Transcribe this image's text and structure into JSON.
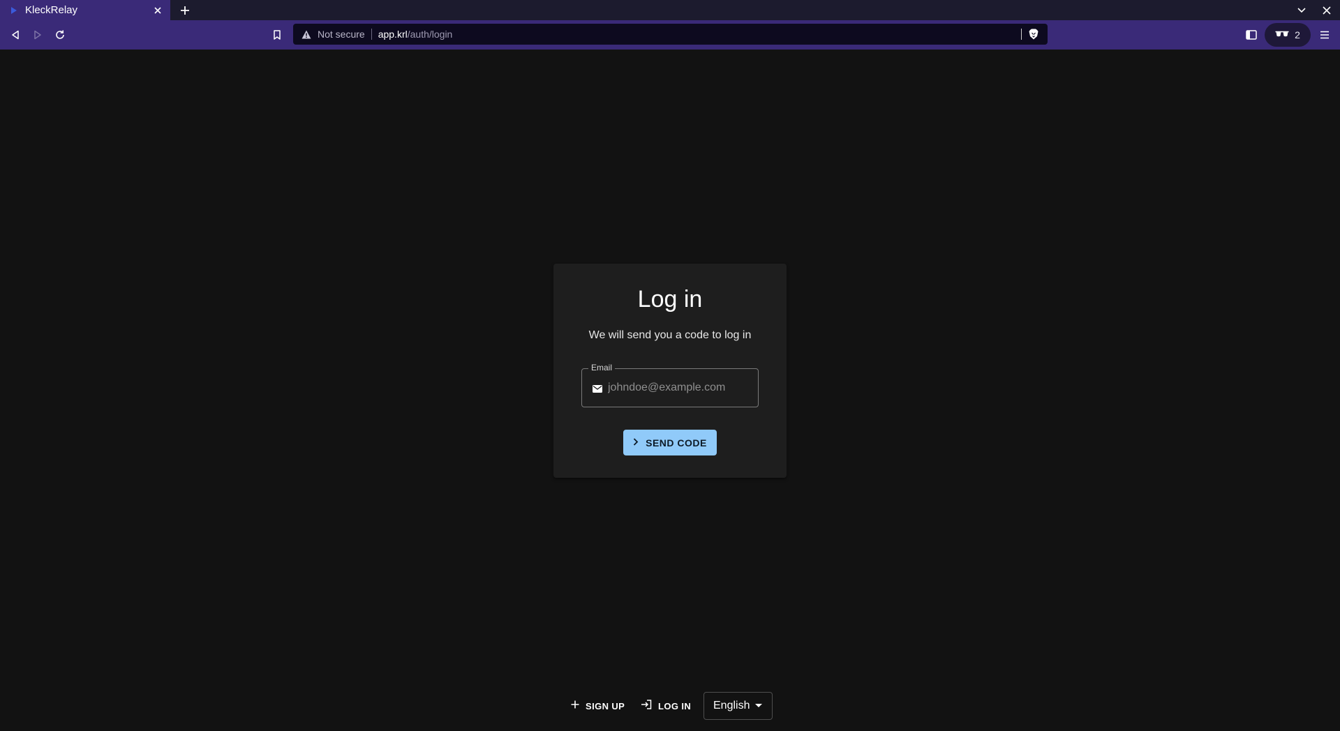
{
  "browser": {
    "tab": {
      "title": "KleckRelay"
    },
    "address_bar": {
      "security_label": "Not secure",
      "host": "app.krl",
      "path": "/auth/login"
    },
    "extensions": {
      "count": "2"
    }
  },
  "login": {
    "title": "Log in",
    "subtitle": "We will send you a code to log in",
    "email": {
      "label": "Email",
      "placeholder": "johndoe@example.com",
      "value": ""
    },
    "send_button": {
      "label": "SEND CODE"
    }
  },
  "footer": {
    "signup_label": "SIGN UP",
    "login_label": "LOG IN",
    "language": {
      "selected": "English"
    }
  },
  "colors": {
    "page_background": "#121212",
    "card_background": "#1e1e1e",
    "primary_button": "#90caf9",
    "browser_accent": "#3a2a78"
  }
}
